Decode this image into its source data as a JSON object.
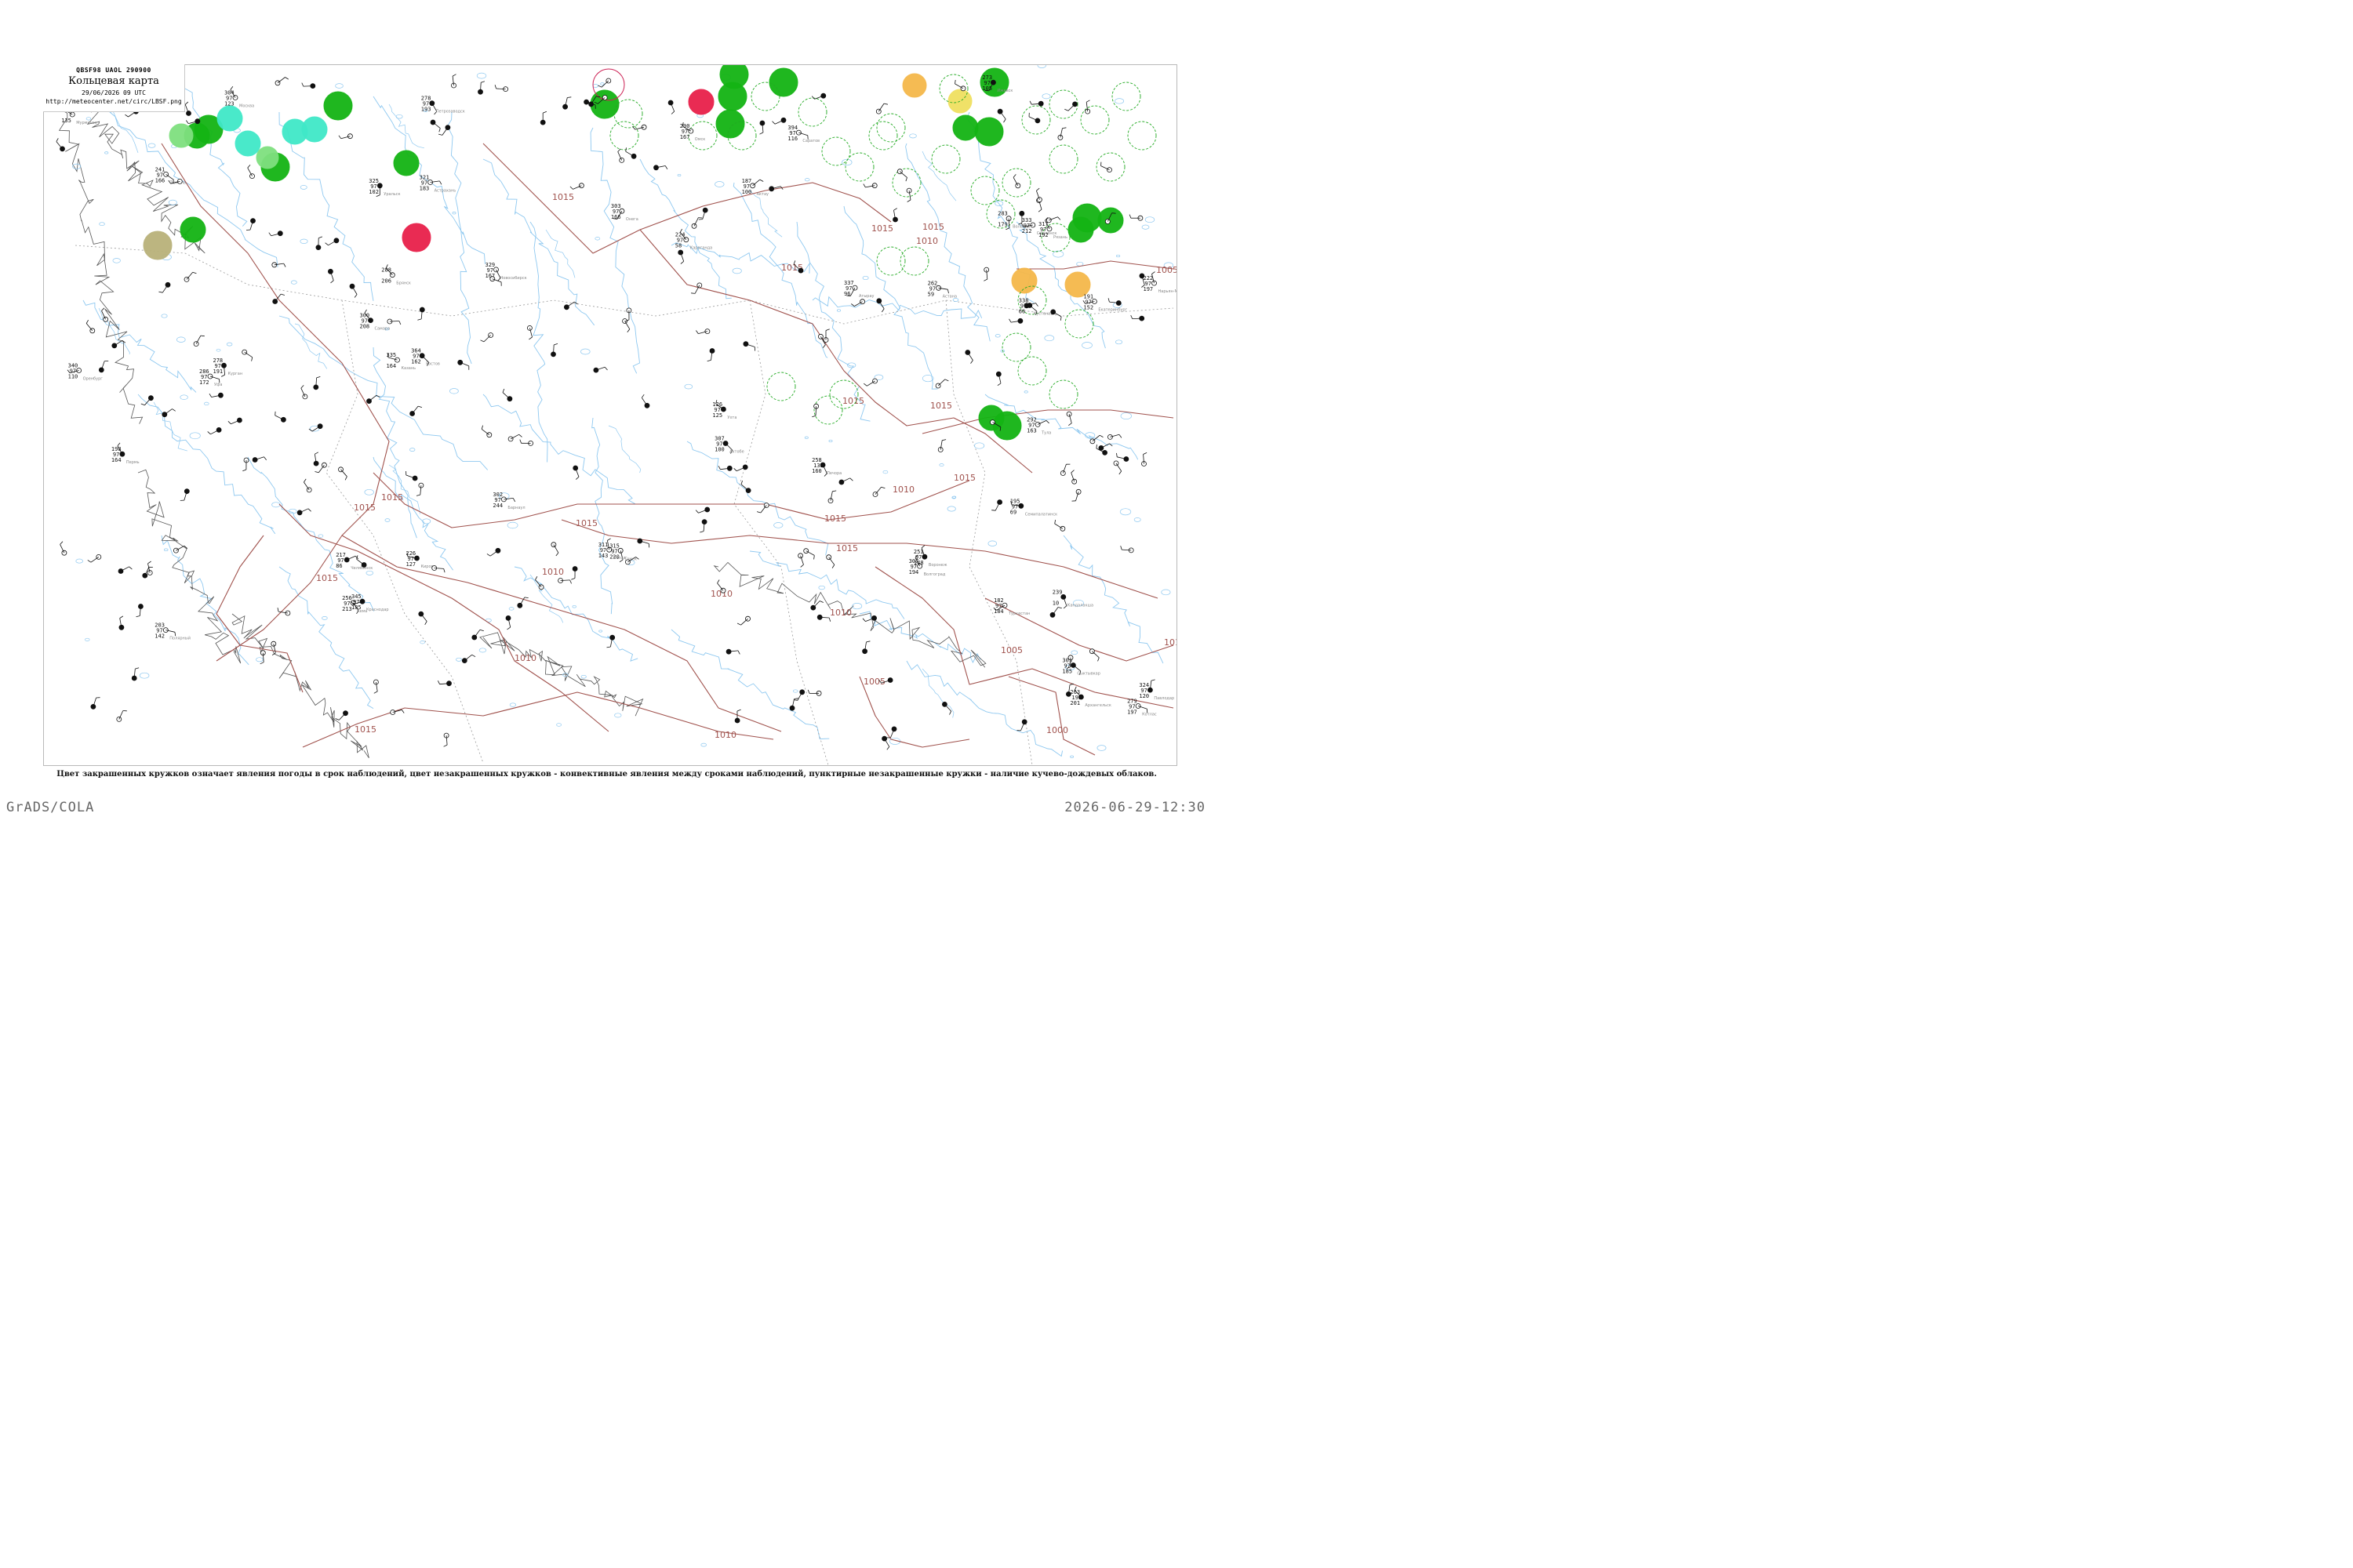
{
  "header": {
    "code": "QBSF98  UAOL  290900",
    "title": "Кольцевая карта",
    "time": "29/06/2026 09 UTC",
    "url": "http://meteocenter.net/circ/LBSF.png"
  },
  "caption": "Цвет закрашенных кружков означает явления погоды в срок наблюдений, цвет незакрашенных кружков - конвективные явления между сроками наблюдений, пунктирные незакрашенные кружки - наличие кучево-дождевых облаков.",
  "footer": {
    "software": "GrADS/COLA",
    "timestamp": "2026-06-29-12:30"
  },
  "colors": {
    "isobar": "#a0524d",
    "river": "#8ec8f0",
    "border": "#999999",
    "coast": "#555555",
    "rain": "#14b414",
    "fog_mist": "#40e8c8",
    "drizzle": "#7fe07f",
    "thunder": "#e8204a",
    "dust": "#b9b27a",
    "haze": "#f5b84a",
    "smoke": "#f0e060",
    "cb_ring": "#22aa22",
    "conv_ring": "#cc2255"
  },
  "isobar_labels": [
    "1015",
    "1015",
    "1015",
    "1015",
    "1015",
    "1015",
    "1015",
    "1015",
    "1015",
    "1015",
    "1015",
    "1015",
    "1015",
    "1015",
    "1010",
    "1010",
    "1010",
    "1010",
    "1010",
    "1010",
    "1010",
    "1005",
    "1005",
    "1005",
    "1000",
    "101"
  ],
  "stations": [
    {
      "p": "203",
      "t": "97",
      "d": "142"
    },
    {
      "p": "254",
      "t": "",
      "d": "135"
    },
    {
      "p": "239",
      "t": "",
      "d": "10"
    },
    {
      "p": "256",
      "t": "97",
      "d": "213"
    },
    {
      "p": "278",
      "t": "97",
      "d": "193"
    },
    {
      "p": "283",
      "t": "",
      "d": "179"
    },
    {
      "p": "263",
      "t": "193",
      "d": "201"
    },
    {
      "p": "303",
      "t": "97",
      "d": "166"
    },
    {
      "p": "279",
      "t": "97",
      "d": "197"
    },
    {
      "p": "303",
      "t": "97",
      "d": "185"
    },
    {
      "p": "258",
      "t": "135",
      "d": "160"
    },
    {
      "p": "222",
      "t": "97",
      "d": "197"
    },
    {
      "p": "126",
      "t": "97",
      "d": "125"
    },
    {
      "p": "226",
      "t": "97",
      "d": "127"
    },
    {
      "p": "198",
      "t": "97",
      "d": "164"
    },
    {
      "p": "191",
      "t": "97",
      "d": "152"
    },
    {
      "p": "241",
      "t": "97",
      "d": "166"
    },
    {
      "p": "278",
      "t": "97",
      "d": "191"
    },
    {
      "p": "290",
      "t": "97",
      "d": "167"
    },
    {
      "p": "329",
      "t": "97",
      "d": "167"
    },
    {
      "p": "302",
      "t": "97",
      "d": "244"
    },
    {
      "p": "315",
      "t": "97",
      "d": "220"
    },
    {
      "p": "335",
      "t": "",
      "d": "164"
    },
    {
      "p": "300",
      "t": "97",
      "d": "208"
    },
    {
      "p": "286",
      "t": "97",
      "d": "172"
    },
    {
      "p": "340",
      "t": "97",
      "d": "110"
    },
    {
      "p": "394",
      "t": "97",
      "d": "116"
    },
    {
      "p": "307",
      "t": "97",
      "d": "194"
    },
    {
      "p": "321",
      "t": "97",
      "d": "183"
    },
    {
      "p": "364",
      "t": "97",
      "d": "162"
    },
    {
      "p": "345",
      "t": "97",
      "d": "185"
    },
    {
      "p": "251",
      "t": "97",
      "d": "148"
    },
    {
      "p": "304",
      "t": "97",
      "d": "123"
    },
    {
      "p": "333",
      "t": "97",
      "d": "212"
    },
    {
      "p": "288",
      "t": "",
      "d": "206"
    },
    {
      "p": "292",
      "t": "97",
      "d": "163"
    },
    {
      "p": "317",
      "t": "97",
      "d": "192"
    },
    {
      "p": "311",
      "t": "97",
      "d": "143"
    },
    {
      "p": "273",
      "t": "97",
      "d": "105"
    },
    {
      "p": "217",
      "t": "97",
      "d": "86"
    },
    {
      "p": "307",
      "t": "97",
      "d": "100"
    },
    {
      "p": "325",
      "t": "97",
      "d": "102"
    },
    {
      "p": "337",
      "t": "97",
      "d": "96"
    },
    {
      "p": "338",
      "t": "97",
      "d": "66"
    },
    {
      "p": "324",
      "t": "97",
      "d": "120"
    },
    {
      "p": "195",
      "t": "97",
      "d": "69"
    },
    {
      "p": "224",
      "t": "97",
      "d": "58"
    },
    {
      "p": "262",
      "t": "97",
      "d": "59"
    },
    {
      "p": "182",
      "t": "97",
      "d": "184"
    },
    {
      "p": "187",
      "t": "97",
      "d": "100"
    }
  ],
  "station_names": [
    "Полярный",
    "Мурманск",
    "Кандалакша",
    "Кемь",
    "Петрозаводск",
    "Вологда",
    "Архангельск",
    "Онега",
    "Котлас",
    "Сыктывкар",
    "Печора",
    "Нарьян-Мар",
    "Ухта",
    "Киров",
    "Пермь",
    "Екатеринбург",
    "Тюмень",
    "Курган",
    "Омск",
    "Новосибирск",
    "Барнаул",
    "Томск",
    "Казань",
    "Самара",
    "Уфа",
    "Оренбург",
    "Саратов",
    "Волгоград",
    "Астрахань",
    "Ростов",
    "Краснодар",
    "Воронеж",
    "Москва",
    "Смоленск",
    "Брянск",
    "Тула",
    "Рязань",
    "Пенза",
    "Ижевск",
    "Челябинск",
    "Актобе",
    "Уральск",
    "Атырау",
    "Кустанай",
    "Павлодар",
    "Семипалатинск",
    "Караганда",
    "Астана",
    "Туркестан",
    "Актау"
  ]
}
